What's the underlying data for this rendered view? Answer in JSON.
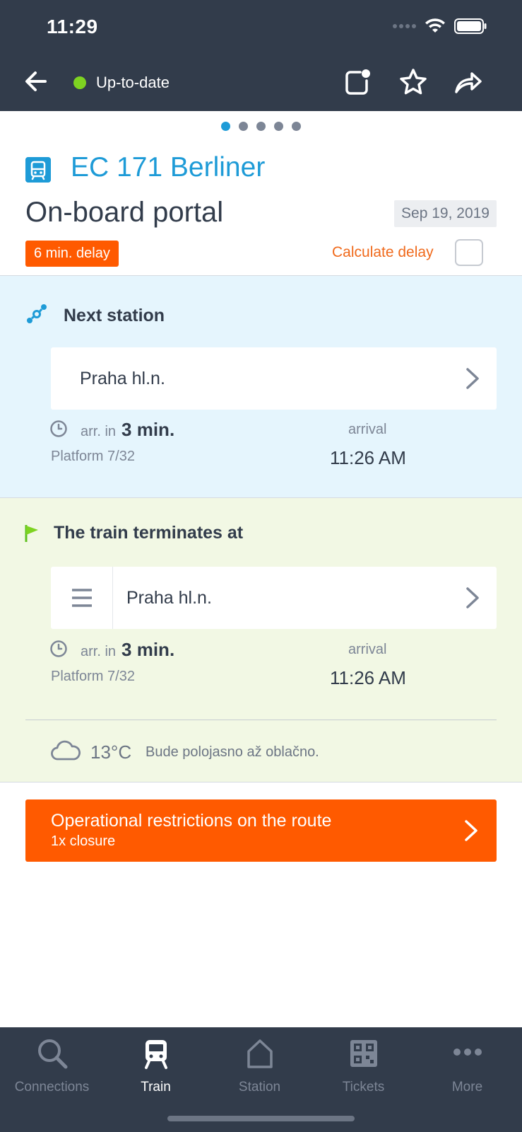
{
  "status_bar": {
    "time": "11:29"
  },
  "header": {
    "live_status": "Up-to-date"
  },
  "pager": {
    "count": 5,
    "active": 0
  },
  "train": {
    "name": "EC 171 Berliner",
    "subtitle": "On-board portal",
    "date": "Sep 19, 2019",
    "delay_badge": "6 min. delay",
    "calculate_delay_label": "Calculate delay"
  },
  "next_station": {
    "title": "Next station",
    "station": "Praha hl.n.",
    "arr_label": "arr. in",
    "arr_value": "3 min.",
    "platform": "Platform 7/32",
    "arrival_label": "arrival",
    "arrival_time": "11:26 AM"
  },
  "terminates": {
    "title": "The train terminates at",
    "station": "Praha hl.n.",
    "arr_label": "arr. in",
    "arr_value": "3 min.",
    "platform": "Platform 7/32",
    "arrival_label": "arrival",
    "arrival_time": "11:26 AM",
    "weather_temp": "13°C",
    "weather_desc": "Bude polojasno až oblačno."
  },
  "restrictions": {
    "title": "Operational restrictions on the route",
    "subtitle": "1x closure"
  },
  "bottom_nav": {
    "items": [
      {
        "label": "Connections",
        "icon": "search-icon"
      },
      {
        "label": "Train",
        "icon": "train-icon"
      },
      {
        "label": "Station",
        "icon": "home-icon"
      },
      {
        "label": "Tickets",
        "icon": "qr-code-icon"
      },
      {
        "label": "More",
        "icon": "more-dots-icon"
      }
    ],
    "active_index": 1
  },
  "colors": {
    "header_bg": "#323c4b",
    "accent_blue": "#1e9bd7",
    "accent_orange": "#ff5a00",
    "live_green": "#7ed321",
    "next_station_bg": "#e5f5fd",
    "terminates_bg": "#f2f8e4"
  }
}
